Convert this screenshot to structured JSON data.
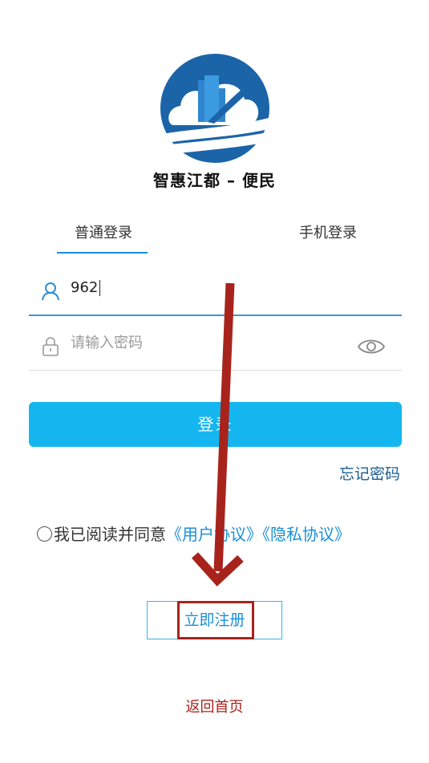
{
  "app": {
    "title": "智惠江都 – 便民",
    "logo_icon": "city-cloud-logo-icon"
  },
  "tabs": [
    {
      "label": "普通登录",
      "active": true
    },
    {
      "label": "手机登录",
      "active": false
    }
  ],
  "form": {
    "username": {
      "value": "962",
      "icon": "user-icon"
    },
    "password": {
      "placeholder": "请输入密码",
      "icon": "lock-icon",
      "toggle_icon": "eye-icon"
    }
  },
  "actions": {
    "login_label": "登录",
    "forgot_label": "忘记密码",
    "register_label": "立即注册",
    "back_label": "返回首页"
  },
  "agreement": {
    "prefix": "我已阅读并同意",
    "user_agreement": "《用户协议》",
    "privacy_agreement": "《隐私协议》",
    "checked": false
  },
  "colors": {
    "accent": "#15b6ef",
    "link": "#1a8fd6",
    "annotation": "#a8231c"
  }
}
